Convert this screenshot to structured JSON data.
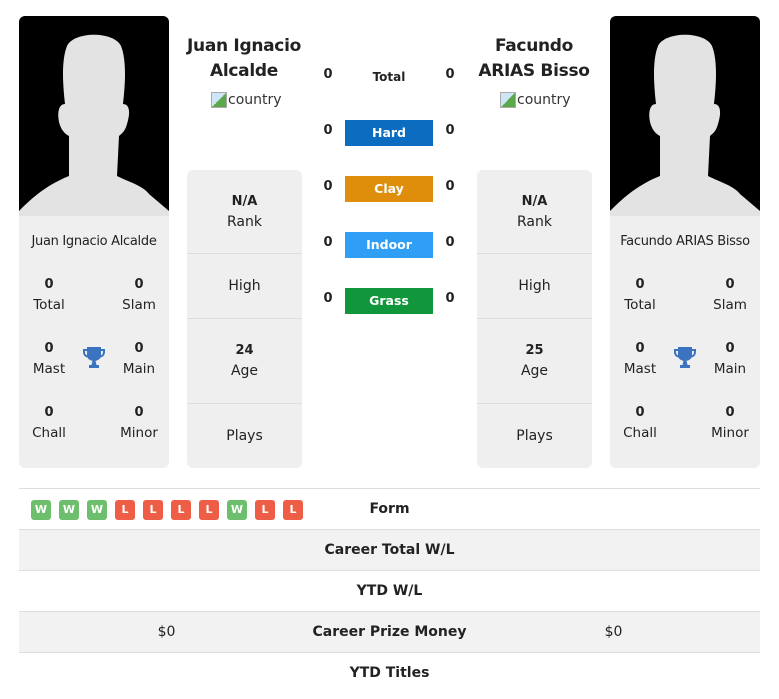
{
  "players": {
    "left": {
      "name_heading": "Juan Ignacio Alcalde",
      "card_name": "Juan Ignacio Alcalde",
      "country_alt": "country",
      "titles": {
        "total": {
          "value": "0",
          "label": "Total"
        },
        "slam": {
          "value": "0",
          "label": "Slam"
        },
        "mast": {
          "value": "0",
          "label": "Mast"
        },
        "main": {
          "value": "0",
          "label": "Main"
        },
        "chall": {
          "value": "0",
          "label": "Chall"
        },
        "minor": {
          "value": "0",
          "label": "Minor"
        }
      },
      "info": {
        "rank": {
          "value": "N/A",
          "label": "Rank"
        },
        "high": {
          "value": "",
          "label": "High"
        },
        "age": {
          "value": "24",
          "label": "Age"
        },
        "plays": {
          "value": "",
          "label": "Plays"
        }
      }
    },
    "right": {
      "name_heading": "Facundo ARIAS Bisso",
      "card_name": "Facundo ARIAS Bisso",
      "country_alt": "country",
      "titles": {
        "total": {
          "value": "0",
          "label": "Total"
        },
        "slam": {
          "value": "0",
          "label": "Slam"
        },
        "mast": {
          "value": "0",
          "label": "Mast"
        },
        "main": {
          "value": "0",
          "label": "Main"
        },
        "chall": {
          "value": "0",
          "label": "Chall"
        },
        "minor": {
          "value": "0",
          "label": "Minor"
        }
      },
      "info": {
        "rank": {
          "value": "N/A",
          "label": "Rank"
        },
        "high": {
          "value": "",
          "label": "High"
        },
        "age": {
          "value": "25",
          "label": "Age"
        },
        "plays": {
          "value": "",
          "label": "Plays"
        }
      }
    }
  },
  "surfaces": [
    {
      "label": "Total",
      "left": "0",
      "right": "0",
      "color": ""
    },
    {
      "label": "Hard",
      "left": "0",
      "right": "0",
      "color": "#0b6cc0"
    },
    {
      "label": "Clay",
      "left": "0",
      "right": "0",
      "color": "#de8e0b"
    },
    {
      "label": "Indoor",
      "left": "0",
      "right": "0",
      "color": "#2f9ef5"
    },
    {
      "label": "Grass",
      "left": "0",
      "right": "0",
      "color": "#12963c"
    }
  ],
  "form": [
    "W",
    "W",
    "W",
    "L",
    "L",
    "L",
    "L",
    "W",
    "L",
    "L"
  ],
  "comparison_rows": [
    {
      "label": "Form",
      "left": "",
      "right": ""
    },
    {
      "label": "Career Total W/L",
      "left": "",
      "right": ""
    },
    {
      "label": "YTD W/L",
      "left": "",
      "right": ""
    },
    {
      "label": "Career Prize Money",
      "left": "$0",
      "right": "$0"
    },
    {
      "label": "YTD Titles",
      "left": "",
      "right": ""
    }
  ],
  "colors": {
    "trophy": "#3b73c0",
    "win": "#6dbf6d",
    "loss": "#ee5d45"
  }
}
